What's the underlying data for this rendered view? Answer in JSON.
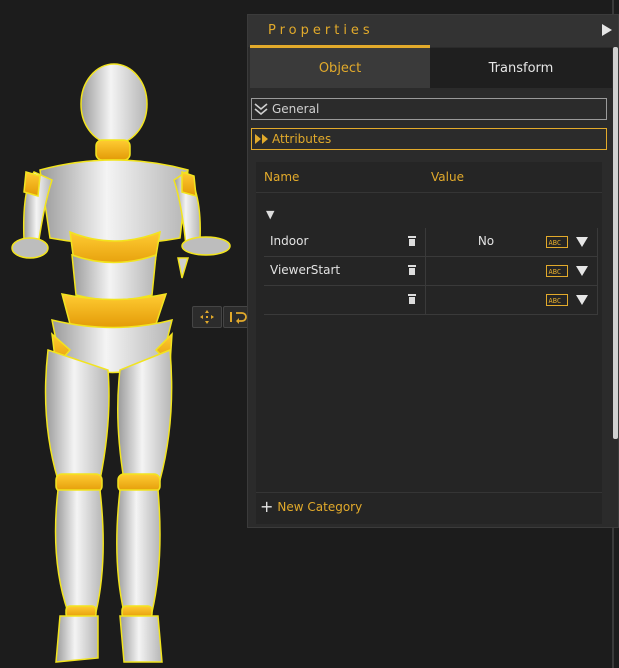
{
  "panel": {
    "title": "Properties",
    "tabs": [
      {
        "label": "Object",
        "active": true
      },
      {
        "label": "Transform",
        "active": false
      }
    ],
    "sections": {
      "general": {
        "label": "General",
        "expanded": false
      },
      "attributes": {
        "label": "Attributes",
        "expanded": true
      }
    },
    "attributes": {
      "columns": {
        "name": "Name",
        "value": "Value"
      },
      "rows": [
        {
          "name": "Indoor",
          "value": "No",
          "type_icon": "abc-icon"
        },
        {
          "name": "ViewerStart",
          "value": "",
          "type_icon": "abc-icon"
        },
        {
          "name": "",
          "value": "",
          "type_icon": "abc-icon"
        }
      ],
      "new_category_label": "New Category"
    }
  },
  "colors": {
    "accent": "#e2aa2b",
    "panel_bg": "#2b2b2b",
    "viewport_bg": "#1c1c1c"
  },
  "gizmo": {
    "icons": [
      "move-icon",
      "undo-icon",
      "layer-icon",
      "up-arrow-icon",
      "down-arrow-icon",
      "physics-icon"
    ]
  }
}
